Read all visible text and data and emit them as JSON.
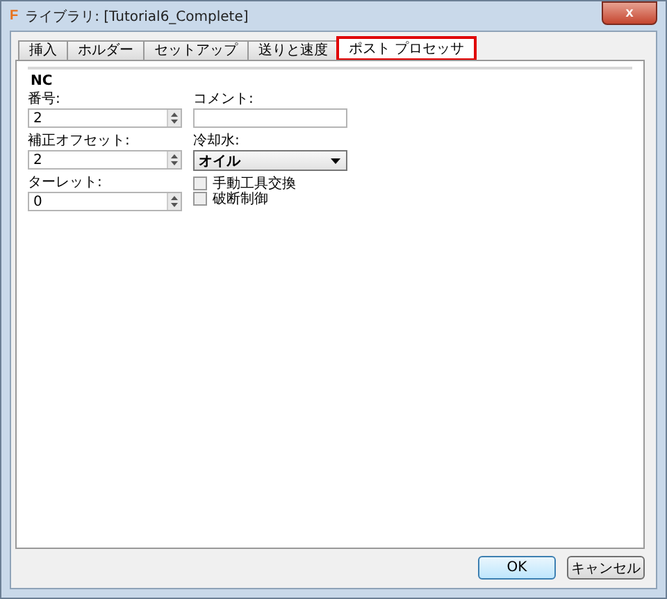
{
  "window": {
    "title": "ライブラリ: [Tutorial6_Complete]",
    "logo": "F",
    "close": "x"
  },
  "tabs": [
    {
      "label": "挿入",
      "selected": false,
      "highlighted": false
    },
    {
      "label": "ホルダー",
      "selected": false,
      "highlighted": false
    },
    {
      "label": "セットアップ",
      "selected": false,
      "highlighted": false
    },
    {
      "label": "送りと速度",
      "selected": false,
      "highlighted": false
    },
    {
      "label": "ポスト プロセッサ",
      "selected": true,
      "highlighted": true
    }
  ],
  "section": "NC",
  "left_fields": [
    {
      "label": "番号:",
      "value": "2"
    },
    {
      "label": "補正オフセット:",
      "value": "2"
    },
    {
      "label": "ターレット:",
      "value": "0"
    }
  ],
  "comment": {
    "label": "コメント:"
  },
  "coolant": {
    "label": "冷却水:",
    "value": "オイル"
  },
  "checkboxes": [
    {
      "label": "手動工具交換",
      "checked": false
    },
    {
      "label": "破断制御",
      "checked": false
    }
  ],
  "buttons": [
    {
      "label": "OK",
      "default": true
    },
    {
      "label": "キャンセル",
      "default": false
    }
  ]
}
